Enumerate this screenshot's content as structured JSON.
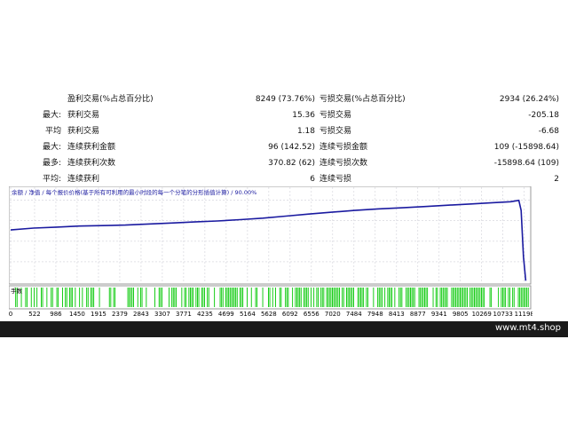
{
  "stats": [
    {
      "c1": "",
      "c2": "盈利交易(%占总百分比)",
      "c3": "8249 (73.76%)",
      "c4": "亏损交易(%占总百分比)",
      "c5": "2934 (26.24%)"
    },
    {
      "c1": "最大:",
      "c2": "获利交易",
      "c3": "15.36",
      "c4": "亏损交易",
      "c5": "-205.18"
    },
    {
      "c1": "平均",
      "c2": "获利交易",
      "c3": "1.18",
      "c4": "亏损交易",
      "c5": "-6.68"
    },
    {
      "c1": "最大:",
      "c2": "连续获利金额",
      "c3": "96 (142.52)",
      "c4": "连续亏损金额",
      "c5": "109 (-15898.64)"
    },
    {
      "c1": "最多:",
      "c2": "连续获利次数",
      "c3": "370.82 (62)",
      "c4": "连续亏损次数",
      "c5": "-15898.64 (109)"
    },
    {
      "c1": "平均:",
      "c2": "连续获利",
      "c3": "6",
      "c4": "连续亏损",
      "c5": "2"
    }
  ],
  "chart_data": {
    "type": "line",
    "legend": "余额 / 净值 / 每个报价价格(基于所有可利用的最小时段的每一个分笔的分形插值计算) / 90.00%",
    "y_ticks": [
      16000,
      12000,
      8000,
      4000,
      0
    ],
    "ylim": [
      0,
      18000
    ],
    "x_ticks": [
      0,
      522,
      986,
      1450,
      1915,
      2379,
      2843,
      3307,
      3771,
      4235,
      4699,
      5164,
      5628,
      6092,
      6556,
      7020,
      7484,
      7948,
      8413,
      8877,
      9341,
      9805,
      10269,
      10733,
      11198
    ],
    "xlim": [
      0,
      11300
    ],
    "series": [
      {
        "x": [
          0,
          500,
          1000,
          1500,
          2000,
          2500,
          3000,
          3500,
          4000,
          4500,
          5000,
          5500,
          6000,
          6500,
          7000,
          7500,
          8000,
          8500,
          9000,
          9500,
          10000,
          10500,
          10900,
          11000,
          11080,
          11130,
          11180,
          11230
        ],
        "y": [
          10200,
          10550,
          10750,
          10950,
          11050,
          11150,
          11350,
          11550,
          11750,
          11950,
          12200,
          12500,
          12900,
          13300,
          13650,
          14000,
          14300,
          14500,
          14750,
          15000,
          15250,
          15500,
          15700,
          15850,
          15950,
          14000,
          5000,
          300
        ]
      }
    ],
    "colors": {
      "line": "#1a1aa0",
      "grid": "#d0d0d8",
      "volume": "#00c800",
      "legend_text": "#1a1aa0"
    },
    "volume_label": "手数",
    "grid": true
  },
  "footer": {
    "site": "www.mt4.shop"
  }
}
